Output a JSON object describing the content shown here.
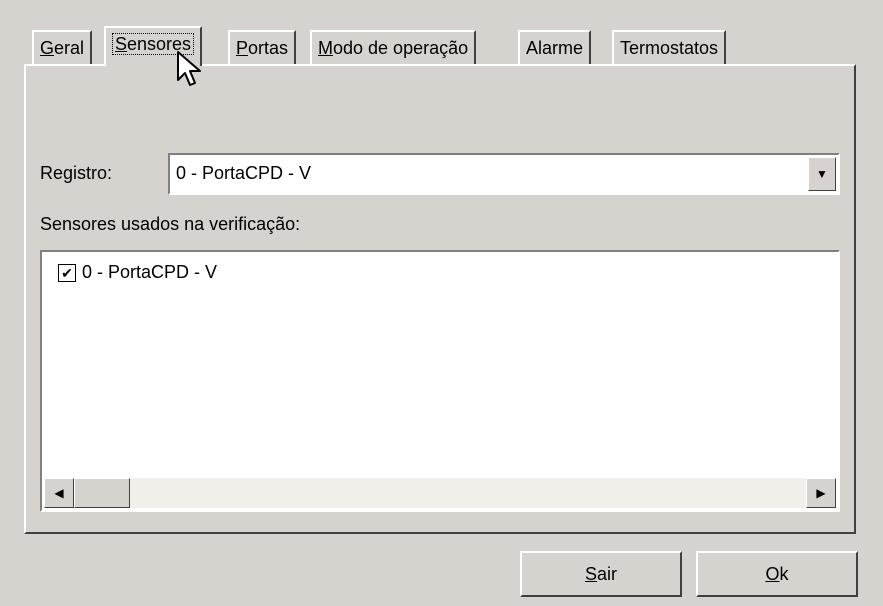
{
  "tabs": [
    {
      "label": "Geral",
      "mnemonic": "G",
      "rest": "eral"
    },
    {
      "label": "Sensores",
      "mnemonic": "S",
      "rest": "ensores"
    },
    {
      "label": "Portas",
      "mnemonic": "P",
      "rest": "ortas"
    },
    {
      "label": "Modo de operação",
      "mnemonic": "M",
      "rest": "odo de operação"
    },
    {
      "label": "Alarme",
      "mnemonic": "",
      "rest": "Alarme"
    },
    {
      "label": "Termostatos",
      "mnemonic": "",
      "rest": "Termostatos"
    }
  ],
  "active_tab": "Sensores",
  "registro": {
    "label": "Registro:",
    "value": "0 - PortaCPD - V"
  },
  "sensors": {
    "label": "Sensores usados na verificação:",
    "items": [
      {
        "label": "0 - PortaCPD - V",
        "checked": true
      }
    ]
  },
  "buttons": {
    "sair": {
      "mnemonic": "S",
      "rest": "air"
    },
    "ok": {
      "mnemonic": "O",
      "rest": "k"
    }
  },
  "icons": {
    "dropdown": "dropdown-arrow-icon",
    "scroll_left": "scroll-left-arrow-icon",
    "scroll_right": "scroll-right-arrow-icon",
    "checkmark": "checkmark-icon",
    "cursor": "mouse-pointer-icon"
  }
}
